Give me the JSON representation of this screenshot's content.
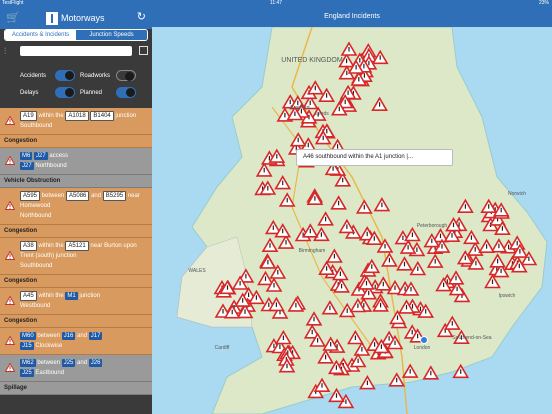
{
  "status": {
    "carrier": "TestFlight",
    "time": "11:47",
    "battery": "23%"
  },
  "app": {
    "logo_text": "Motorways"
  },
  "tabs": [
    {
      "label": "Accidents & Incidents",
      "active": true
    },
    {
      "label": "Junction Speeds",
      "active": false
    }
  ],
  "search": {
    "placeholder": ""
  },
  "toggles": {
    "accidents": {
      "label": "Accidents",
      "on": true
    },
    "roadworks": {
      "label": "Roadworks",
      "on": false
    },
    "delays": {
      "label": "Delays",
      "on": true
    },
    "planned": {
      "label": "Planned",
      "on": true
    }
  },
  "incidents": [
    {
      "color": "orange",
      "parts": [
        {
          "t": "A19",
          "tag": "w"
        },
        {
          "t": " within the "
        },
        {
          "t": "A1018",
          "tag": "w"
        },
        {
          "t": " "
        },
        {
          "t": "B1404",
          "tag": "w"
        },
        {
          "t": " junction"
        }
      ],
      "direction": "Southbound",
      "category": "Congestion"
    },
    {
      "color": "grey",
      "parts": [
        {
          "t": "M6",
          "tag": "b"
        },
        {
          "t": " "
        },
        {
          "t": "J27",
          "tag": "b"
        },
        {
          "t": " access"
        }
      ],
      "subtag": "J27",
      "direction": "Northbound",
      "category": "Vehicle Obstruction"
    },
    {
      "color": "orange",
      "parts": [
        {
          "t": "A595",
          "tag": "w"
        },
        {
          "t": " between "
        },
        {
          "t": "A5086",
          "tag": "w"
        },
        {
          "t": " and "
        },
        {
          "t": "B5295",
          "tag": "w"
        },
        {
          "t": " near Homewood"
        }
      ],
      "direction": "Northbound",
      "category": "Congestion"
    },
    {
      "color": "orange",
      "parts": [
        {
          "t": "A38",
          "tag": "w"
        },
        {
          "t": " within the "
        },
        {
          "t": "A5121",
          "tag": "w"
        },
        {
          "t": " near Burton upon Trent (south) junction"
        }
      ],
      "direction": "Southbound",
      "category": "Congestion"
    },
    {
      "color": "orange",
      "parts": [
        {
          "t": "A45",
          "tag": "w"
        },
        {
          "t": " within the "
        },
        {
          "t": "M1",
          "tag": "b"
        },
        {
          "t": " junction"
        }
      ],
      "direction": "Westbound",
      "category": "Congestion"
    },
    {
      "color": "orange",
      "parts": [
        {
          "t": "M60",
          "tag": "b"
        },
        {
          "t": " between "
        },
        {
          "t": "J16",
          "tag": "b"
        },
        {
          "t": " and "
        },
        {
          "t": "J17",
          "tag": "b"
        }
      ],
      "subtag": "J15",
      "direction": "Clockwise",
      "category": ""
    },
    {
      "color": "grey",
      "parts": [
        {
          "t": "M62",
          "tag": "b"
        },
        {
          "t": " between "
        },
        {
          "t": "J25",
          "tag": "b"
        },
        {
          "t": " and "
        },
        {
          "t": "J26",
          "tag": "b"
        }
      ],
      "subtag": "J25",
      "direction": "Eastbound",
      "category": "Spillage"
    }
  ],
  "map": {
    "title": "England Incidents",
    "callout": "A46 southbound within the A1 junction |...",
    "places": [
      "UNITED KINGDOM",
      "Bradford",
      "Leeds",
      "WALES",
      "Norwich",
      "Birmingham",
      "London",
      "Cardiff",
      "Peterborough",
      "Ipswich",
      "Southend-on-Sea"
    ]
  }
}
